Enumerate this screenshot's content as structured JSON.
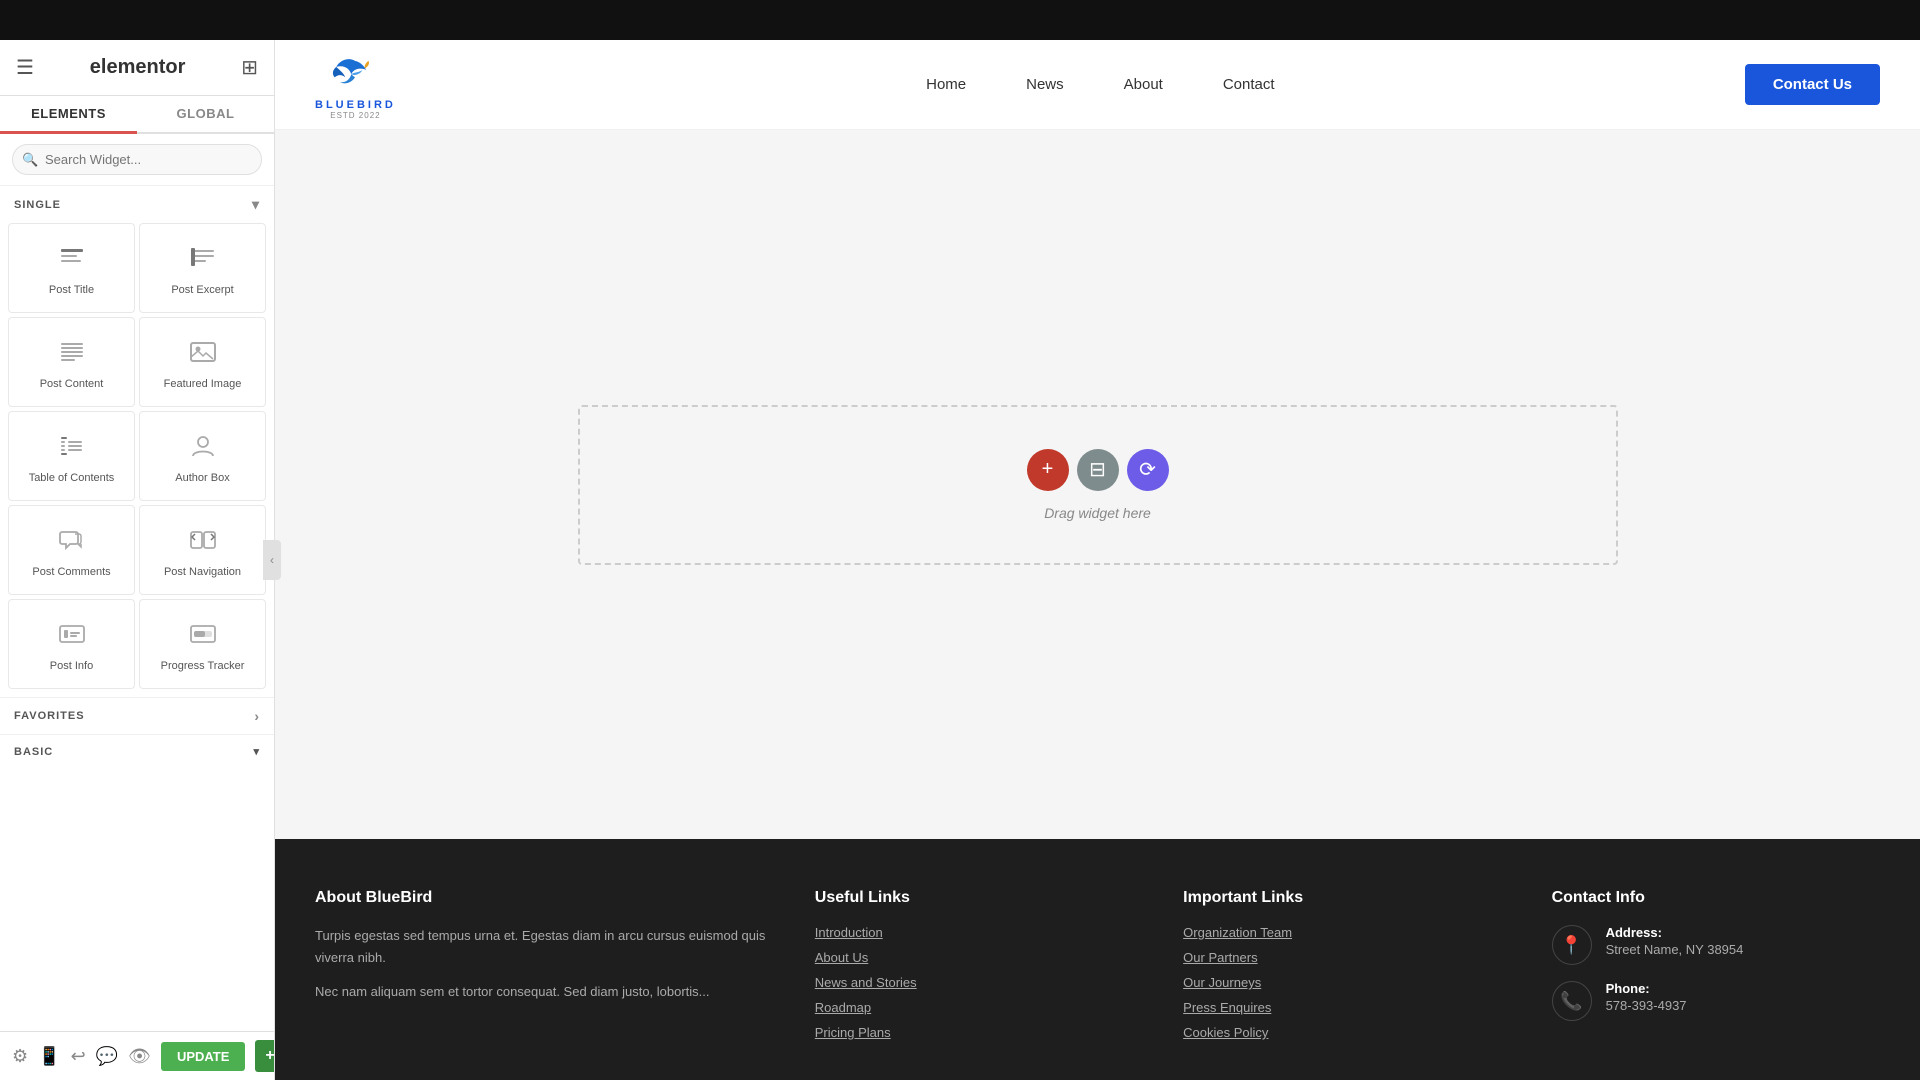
{
  "topBar": {
    "bg": "#111"
  },
  "sidebar": {
    "brand": "elementor",
    "tabs": [
      "ELEMENTS",
      "GLOBAL"
    ],
    "activeTab": 0,
    "search": {
      "placeholder": "Search Widget..."
    },
    "single": {
      "label": "SINGLE",
      "widgets": [
        {
          "id": "post-title",
          "label": "Post Title",
          "icon": "📄"
        },
        {
          "id": "post-excerpt",
          "label": "Post Excerpt",
          "icon": "📝"
        },
        {
          "id": "post-content",
          "label": "Post Content",
          "icon": "📋"
        },
        {
          "id": "featured-image",
          "label": "Featured Image",
          "icon": "🖼"
        },
        {
          "id": "table-of-contents",
          "label": "Table of Contents",
          "icon": "📑"
        },
        {
          "id": "author-box",
          "label": "Author Box",
          "icon": "👤"
        },
        {
          "id": "post-comments",
          "label": "Post Comments",
          "icon": "💬"
        },
        {
          "id": "post-navigation",
          "label": "Post Navigation",
          "icon": "🧭"
        },
        {
          "id": "post-info",
          "label": "Post Info",
          "icon": "ℹ"
        },
        {
          "id": "progress-tracker",
          "label": "Progress Tracker",
          "icon": "📊"
        }
      ]
    },
    "favorites": {
      "label": "FAVORITES"
    },
    "basic": {
      "label": "BASIC"
    },
    "bottomIcons": [
      "⚙",
      "🔄",
      "↩",
      "💬",
      "👁"
    ],
    "updateBtn": "UPDATE",
    "updatePlusBtn": "+"
  },
  "siteNav": {
    "logoText": "BLUEBIRD",
    "logoSub": "ESTD 2022",
    "links": [
      "Home",
      "News",
      "About",
      "Contact"
    ],
    "ctaButton": "Contact Us"
  },
  "dropZone": {
    "label": "Drag widget here"
  },
  "footer": {
    "about": {
      "title": "About BlueBird",
      "text1": "Turpis egestas sed tempus urna et. Egestas diam in arcu cursus euismod quis viverra nibh.",
      "text2": "Nec nam aliquam sem et tortor consequat. Sed diam justo, lobortis..."
    },
    "usefulLinks": {
      "title": "Useful Links",
      "links": [
        "Introduction",
        "About Us",
        "News and Stories",
        "Roadmap",
        "Pricing Plans"
      ]
    },
    "importantLinks": {
      "title": "Important Links",
      "links": [
        "Organization Team",
        "Our Partners",
        "Our Journeys",
        "Press Enquires",
        "Cookies Policy"
      ]
    },
    "contactInfo": {
      "title": "Contact Info",
      "address": {
        "label": "Address:",
        "value": "Street Name, NY 38954"
      },
      "phone": {
        "label": "Phone:",
        "value": "578-393-4937"
      }
    }
  }
}
